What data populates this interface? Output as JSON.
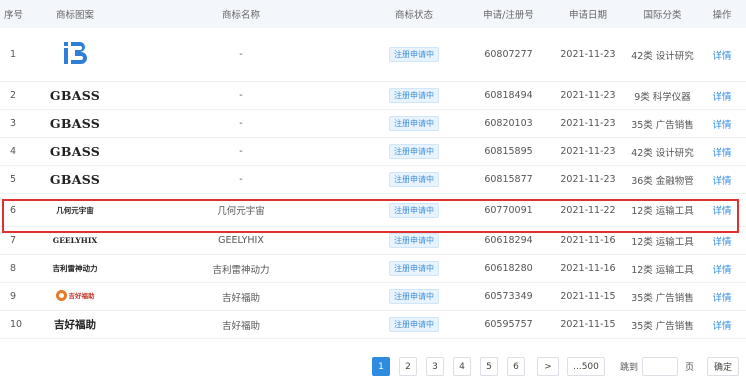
{
  "table": {
    "headers": {
      "seq": "序号",
      "logo": "商标图案",
      "name": "商标名称",
      "status": "商标状态",
      "regno": "申请/注册号",
      "date": "申请日期",
      "cls": "国际分类",
      "op": "操作"
    },
    "rows": [
      {
        "seq": "1",
        "logo_text": "iB",
        "logo_kind": "ib-icon",
        "name": "-",
        "status": "注册申请中",
        "regno": "60807277",
        "date": "2021-11-23",
        "cls": "42类 设计研究",
        "op": "详情"
      },
      {
        "seq": "2",
        "logo_text": "GBASS",
        "name": "-",
        "status": "注册申请中",
        "regno": "60818494",
        "date": "2021-11-23",
        "cls": "9类 科学仪器",
        "op": "详情"
      },
      {
        "seq": "3",
        "logo_text": "GBASS",
        "name": "-",
        "status": "注册申请中",
        "regno": "60820103",
        "date": "2021-11-23",
        "cls": "35类 广告销售",
        "op": "详情"
      },
      {
        "seq": "4",
        "logo_text": "GBASS",
        "name": "-",
        "status": "注册申请中",
        "regno": "60815895",
        "date": "2021-11-23",
        "cls": "42类 设计研究",
        "op": "详情"
      },
      {
        "seq": "5",
        "logo_text": "GBASS",
        "name": "-",
        "status": "注册申请中",
        "regno": "60815877",
        "date": "2021-11-23",
        "cls": "36类 金融物管",
        "op": "详情"
      },
      {
        "seq": "6",
        "logo_text": "几何元宇宙",
        "name": "几何元宇宙",
        "status": "注册申请中",
        "regno": "60770091",
        "date": "2021-11-22",
        "cls": "12类 运输工具",
        "op": "详情"
      },
      {
        "seq": "7",
        "logo_text": "GEELYHIX",
        "name": "GEELYHIX",
        "status": "注册申请中",
        "regno": "60618294",
        "date": "2021-11-16",
        "cls": "12类 运输工具",
        "op": "详情"
      },
      {
        "seq": "8",
        "logo_text": "吉利雷神动力",
        "name": "吉利雷神动力",
        "status": "注册申请中",
        "regno": "60618280",
        "date": "2021-11-16",
        "cls": "12类 运输工具",
        "op": "详情"
      },
      {
        "seq": "9",
        "logo_text": "吉好福助",
        "logo_kind": "jh-icon",
        "name": "吉好福助",
        "status": "注册申请中",
        "regno": "60573349",
        "date": "2021-11-15",
        "cls": "35类 广告销售",
        "op": "详情"
      },
      {
        "seq": "10",
        "logo_text": "吉好福助",
        "name": "吉好福助",
        "status": "注册申请中",
        "regno": "60595757",
        "date": "2021-11-15",
        "cls": "35类 广告销售",
        "op": "详情"
      }
    ]
  },
  "pagination": {
    "pages": [
      "1",
      "2",
      "3",
      "4",
      "5",
      "6"
    ],
    "active": "1",
    "next": ">",
    "last": "...500",
    "jump_label": "跳到",
    "page_unit": "页",
    "confirm": "确定"
  },
  "colors": {
    "accent": "#2f8be0",
    "highlight": "#e03131",
    "header_bg": "#f3f6fb",
    "tag_bg": "#e8f3fd"
  }
}
